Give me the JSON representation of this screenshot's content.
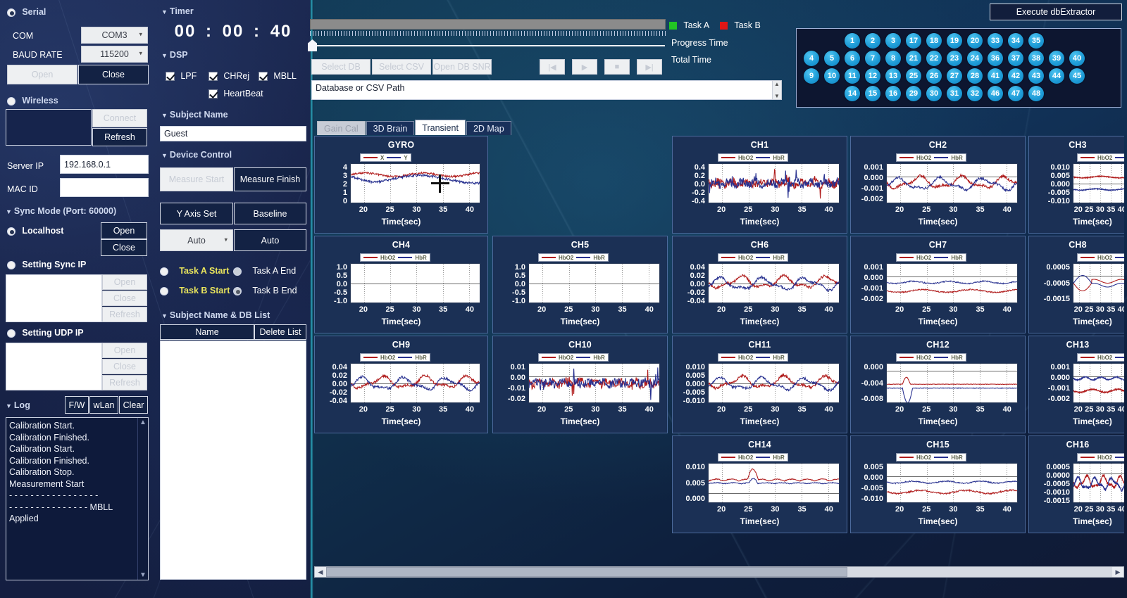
{
  "serial": {
    "section_label": "Serial",
    "com_label": "COM",
    "com_value": "COM3",
    "baud_label": "BAUD RATE",
    "baud_value": "115200",
    "open_label": "Open",
    "close_label": "Close"
  },
  "wireless": {
    "section_label": "Wireless",
    "connect_label": "Connect",
    "refresh_label": "Refresh",
    "server_ip_label": "Server IP",
    "server_ip_value": "192.168.0.1",
    "mac_id_label": "MAC ID",
    "mac_id_value": ""
  },
  "sync": {
    "section_label": "Sync Mode (Port: 60000)",
    "localhost_label": "Localhost",
    "localhost_open": "Open",
    "localhost_close": "Close",
    "sync_ip_label": "Setting Sync IP",
    "sync_open": "Open",
    "sync_close": "Close",
    "sync_refresh": "Refresh",
    "udp_ip_label": "Setting UDP IP",
    "udp_open": "Open",
    "udp_close": "Close",
    "udp_refresh": "Refresh"
  },
  "log": {
    "section_label": "Log",
    "fw_label": "F/W",
    "wlan_label": "wLan",
    "clear_label": "Clear",
    "lines": [
      "Calibration Start.",
      "Calibration Finished.",
      "Calibration Start.",
      "Calibration Finished.",
      "Calibration Stop.",
      "Measurement Start",
      "- - - - - - - - - - - - - - - - -",
      "- - - - - - - - - - - - - - -  MBLL",
      "Applied"
    ]
  },
  "timer": {
    "section_label": "Timer",
    "hours": "00",
    "minutes": "00",
    "seconds": "40",
    "sep": ":"
  },
  "dsp": {
    "section_label": "DSP",
    "lpf_label": "LPF",
    "chrej_label": "CHRej",
    "mbll_label": "MBLL",
    "heartbeat_label": "HeartBeat",
    "lpf_checked": true,
    "chrej_checked": true,
    "mbll_checked": true,
    "heartbeat_checked": true
  },
  "subject": {
    "section_label": "Subject Name",
    "value": "Guest"
  },
  "device_control": {
    "section_label": "Device Control",
    "measure_start": "Measure Start",
    "measure_finish": "Measure Finish",
    "y_axis_set": "Y Axis Set",
    "baseline": "Baseline",
    "y_axis_mode": "Auto",
    "baseline_mode": "Auto",
    "task_a_start": "Task A Start",
    "task_a_end": "Task A End",
    "task_b_start": "Task B Start",
    "task_b_end": "Task B End",
    "selected_task": "task_b_end"
  },
  "db_list": {
    "section_label": "Subject Name & DB List",
    "name_label": "Name",
    "delete_label": "Delete List",
    "items": []
  },
  "toolbar": {
    "execute_db_extractor": "Execute dbExtractor",
    "select_db": "Select DB",
    "select_csv": "Select CSV",
    "open_db_snr": "Open DB SNR",
    "transport": [
      "first",
      "play",
      "stop",
      "last"
    ],
    "transport_glyphs": [
      "|◀",
      "▶",
      "■",
      "▶|"
    ],
    "progress_time_label": "Progress Time",
    "total_time_label": "Total Time",
    "progress_time_value": "",
    "total_time_value": "",
    "task_a_label": "Task A",
    "task_b_label": "Task B",
    "task_a_color": "#22c423",
    "task_b_color": "#e01616",
    "path_placeholder": "Database or CSV Path",
    "path_value": "Database or CSV Path"
  },
  "channel_grid": {
    "rows": [
      [
        "",
        "",
        "1",
        "2",
        "3",
        "17",
        "18",
        "19",
        "20",
        "33",
        "34",
        "35",
        "",
        ""
      ],
      [
        "4",
        "5",
        "6",
        "7",
        "8",
        "21",
        "22",
        "23",
        "24",
        "36",
        "37",
        "38",
        "39",
        "40"
      ],
      [
        "9",
        "10",
        "11",
        "12",
        "13",
        "25",
        "26",
        "27",
        "28",
        "41",
        "42",
        "43",
        "44",
        "45"
      ],
      [
        "",
        "",
        "14",
        "15",
        "16",
        "29",
        "30",
        "31",
        "32",
        "46",
        "47",
        "48",
        "",
        ""
      ]
    ]
  },
  "tabs": [
    {
      "label": "Gain Cal",
      "state": "disabled"
    },
    {
      "label": "3D Brain",
      "state": "inactive"
    },
    {
      "label": "Transient",
      "state": "active"
    },
    {
      "label": "2D Map",
      "state": "inactive"
    }
  ],
  "chart_data": {
    "type": "line",
    "xlabel": "Time(sec)",
    "x": [
      20,
      25,
      30,
      35,
      40
    ],
    "xlim": [
      17.5,
      42
    ],
    "grid": true,
    "legend_position": "top-left",
    "charts": [
      {
        "title": "GYRO",
        "series": [
          {
            "name": "X",
            "color": "#b01c1c"
          },
          {
            "name": "Y",
            "color": "#27308f"
          }
        ],
        "yticks": [
          "4",
          "3",
          "2",
          "1",
          "0"
        ],
        "ylim": [
          0,
          4
        ],
        "zero_at": 1.0,
        "shape": "gyro"
      },
      {
        "title": "CH1",
        "series": [
          {
            "name": "HbO2",
            "color": "#b01c1c"
          },
          {
            "name": "HbR",
            "color": "#27308f"
          }
        ],
        "yticks": [
          "0.4",
          "0.2",
          "0.0",
          "-0.2",
          "-0.4"
        ],
        "ylim": [
          -0.4,
          0.4
        ],
        "zero_at": 0.5,
        "shape": "spiky"
      },
      {
        "title": "CH2",
        "series": [
          {
            "name": "HbO2",
            "color": "#b01c1c"
          },
          {
            "name": "HbR",
            "color": "#27308f"
          }
        ],
        "yticks": [
          "0.001",
          "0.000",
          "-0.001",
          "-0.002"
        ],
        "ylim": [
          -0.002,
          0.001
        ],
        "zero_at": 0.33,
        "shape": "wavy"
      },
      {
        "title": "CH3",
        "series": [
          {
            "name": "HbO2",
            "color": "#b01c1c"
          },
          {
            "name": "HbR",
            "color": "#27308f"
          }
        ],
        "yticks": [
          "0.010",
          "0.005",
          "0.000",
          "-0.005",
          "-0.010"
        ],
        "ylim": [
          -0.01,
          0.01
        ],
        "zero_at": 0.5,
        "shape": "flat-split"
      },
      {
        "title": "CH4",
        "series": [
          {
            "name": "HbO2",
            "color": "#b01c1c"
          },
          {
            "name": "HbR",
            "color": "#27308f"
          }
        ],
        "yticks": [
          "1.0",
          "0.5",
          "0.0",
          "-0.5",
          "-1.0"
        ],
        "ylim": [
          -1,
          1
        ],
        "zero_at": 0.5,
        "shape": "empty"
      },
      {
        "title": "CH5",
        "series": [
          {
            "name": "HbO2",
            "color": "#b01c1c"
          },
          {
            "name": "HbR",
            "color": "#27308f"
          }
        ],
        "yticks": [
          "1.0",
          "0.5",
          "0.0",
          "-0.5",
          "-1.0"
        ],
        "ylim": [
          -1,
          1
        ],
        "zero_at": 0.5,
        "shape": "empty"
      },
      {
        "title": "CH6",
        "series": [
          {
            "name": "HbO2",
            "color": "#b01c1c"
          },
          {
            "name": "HbR",
            "color": "#27308f"
          }
        ],
        "yticks": [
          "0.04",
          "0.02",
          "0.00",
          "-0.02",
          "-0.04"
        ],
        "ylim": [
          -0.04,
          0.04
        ],
        "zero_at": 0.5,
        "shape": "wavy"
      },
      {
        "title": "CH7",
        "series": [
          {
            "name": "HbO2",
            "color": "#b01c1c"
          },
          {
            "name": "HbR",
            "color": "#27308f"
          }
        ],
        "yticks": [
          "0.001",
          "0.000",
          "-0.001",
          "-0.002"
        ],
        "ylim": [
          -0.002,
          0.001
        ],
        "zero_at": 0.33,
        "shape": "split"
      },
      {
        "title": "CH8",
        "series": [
          {
            "name": "HbO2",
            "color": "#b01c1c"
          },
          {
            "name": "HbR",
            "color": "#27308f"
          }
        ],
        "yticks": [
          "0.0005",
          "-0.0005",
          "-0.0015"
        ],
        "ylim": [
          -0.002,
          0.001
        ],
        "zero_at": 0.3,
        "shape": "cross"
      },
      {
        "title": "CH9",
        "series": [
          {
            "name": "HbO2",
            "color": "#b01c1c"
          },
          {
            "name": "HbR",
            "color": "#27308f"
          }
        ],
        "yticks": [
          "0.04",
          "0.02",
          "0.00",
          "-0.02",
          "-0.04"
        ],
        "ylim": [
          -0.04,
          0.04
        ],
        "zero_at": 0.5,
        "shape": "wavy"
      },
      {
        "title": "CH10",
        "series": [
          {
            "name": "HbO2",
            "color": "#b01c1c"
          },
          {
            "name": "HbR",
            "color": "#27308f"
          }
        ],
        "yticks": [
          "0.01",
          "0.00",
          "-0.01",
          "-0.02"
        ],
        "ylim": [
          -0.02,
          0.01
        ],
        "zero_at": 0.33,
        "shape": "spiky"
      },
      {
        "title": "CH11",
        "series": [
          {
            "name": "HbO2",
            "color": "#b01c1c"
          },
          {
            "name": "HbR",
            "color": "#27308f"
          }
        ],
        "yticks": [
          "0.010",
          "0.005",
          "0.000",
          "-0.005",
          "-0.010"
        ],
        "ylim": [
          -0.01,
          0.01
        ],
        "zero_at": 0.5,
        "shape": "wavy"
      },
      {
        "title": "CH12",
        "series": [
          {
            "name": "HbO2",
            "color": "#b01c1c"
          },
          {
            "name": "HbR",
            "color": "#27308f"
          }
        ],
        "yticks": [
          "0.000",
          "-0.004",
          "-0.008"
        ],
        "ylim": [
          -0.008,
          0.001
        ],
        "zero_at": 0.18,
        "shape": "dip"
      },
      {
        "title": "CH13",
        "series": [
          {
            "name": "HbO2",
            "color": "#b01c1c"
          },
          {
            "name": "HbR",
            "color": "#27308f"
          }
        ],
        "yticks": [
          "0.001",
          "0.000",
          "-0.001",
          "-0.002"
        ],
        "ylim": [
          -0.002,
          0.001
        ],
        "zero_at": 0.33,
        "shape": "split-inv"
      },
      {
        "title": "CH14",
        "series": [
          {
            "name": "HbO2",
            "color": "#b01c1c"
          },
          {
            "name": "HbR",
            "color": "#27308f"
          }
        ],
        "yticks": [
          "0.010",
          "0.005",
          "0.000"
        ],
        "ylim": [
          -0.003,
          0.01
        ],
        "zero_at": 0.77,
        "shape": "peak"
      },
      {
        "title": "CH15",
        "series": [
          {
            "name": "HbO2",
            "color": "#b01c1c"
          },
          {
            "name": "HbR",
            "color": "#27308f"
          }
        ],
        "yticks": [
          "0.005",
          "0.000",
          "-0.005",
          "-0.010"
        ],
        "ylim": [
          -0.01,
          0.005
        ],
        "zero_at": 0.33,
        "shape": "offset"
      },
      {
        "title": "CH16",
        "series": [
          {
            "name": "HbO2",
            "color": "#b01c1c"
          },
          {
            "name": "HbR",
            "color": "#27308f"
          }
        ],
        "yticks": [
          "0.0005",
          "0.0000",
          "-0.0005",
          "-0.0010",
          "-0.0015"
        ],
        "ylim": [
          -0.0015,
          0.0005
        ],
        "zero_at": 0.25,
        "shape": "wavy"
      }
    ]
  }
}
